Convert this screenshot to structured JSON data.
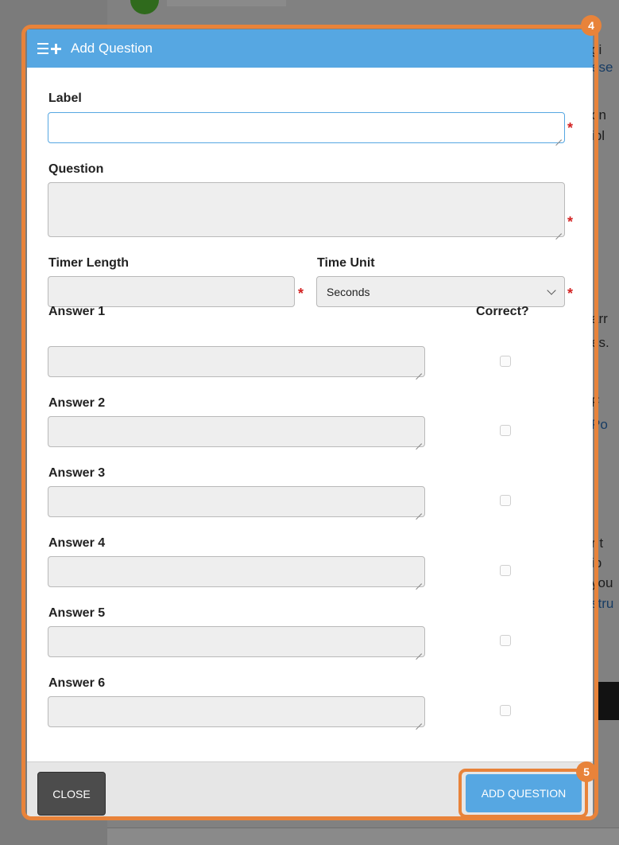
{
  "background": {
    "snippets": [
      "gi",
      "ese",
      "on",
      "ibl",
      "arr",
      "es.",
      "F",
      "Po",
      "r t",
      "ib",
      "you",
      "stru"
    ]
  },
  "modal": {
    "title": "Add Question",
    "label_field": {
      "label": "Label",
      "value": "",
      "required": "*"
    },
    "question_field": {
      "label": "Question",
      "value": "",
      "required": "*"
    },
    "timer_length": {
      "label": "Timer Length",
      "value": "",
      "required": "*"
    },
    "time_unit": {
      "label": "Time Unit",
      "selected": "Seconds",
      "required": "*"
    },
    "correct_header": "Correct?",
    "answers": [
      {
        "label": "Answer 1",
        "value": "",
        "correct": false
      },
      {
        "label": "Answer 2",
        "value": "",
        "correct": false
      },
      {
        "label": "Answer 3",
        "value": "",
        "correct": false
      },
      {
        "label": "Answer 4",
        "value": "",
        "correct": false
      },
      {
        "label": "Answer 5",
        "value": "",
        "correct": false
      },
      {
        "label": "Answer 6",
        "value": "",
        "correct": false
      }
    ],
    "footer": {
      "close_label": "CLOSE",
      "add_label": "ADD QUESTION"
    }
  },
  "steps": {
    "modal_step": "4",
    "button_step": "5"
  },
  "colors": {
    "accent": "#56a7e2",
    "highlight": "#e8833a",
    "required": "#d32323"
  },
  "icons": {
    "header": "list-add-icon",
    "dropdown": "chevron-down-icon",
    "resize": "resize-handle-icon"
  }
}
